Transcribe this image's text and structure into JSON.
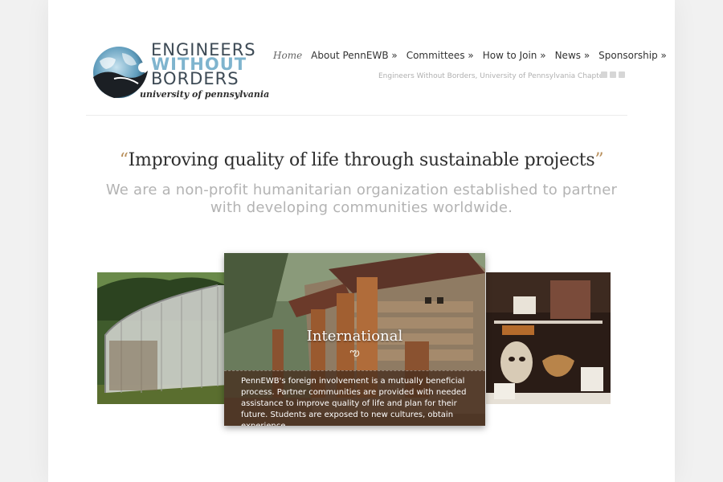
{
  "logo": {
    "line1": "ENGINEERS",
    "line2": "WITHOUT",
    "line3": "BORDERS",
    "line4": "university of pennsylvania"
  },
  "nav": {
    "items": [
      {
        "label": "Home"
      },
      {
        "label": "About PennEWB »"
      },
      {
        "label": "Committees »"
      },
      {
        "label": "How to Join »"
      },
      {
        "label": "News »"
      },
      {
        "label": "Sponsorship »"
      }
    ]
  },
  "header": {
    "tagline": "Engineers Without Borders, University of Pennsylvania Chapter",
    "social": [
      "twitter-icon",
      "rss-icon",
      "facebook-icon"
    ]
  },
  "hero": {
    "quote_open": "“",
    "quote_text": "Improving quality of life through sustainable projects",
    "quote_close": "”",
    "subtitle": "We are a non-profit humanitarian organization established to partner with developing communities worldwide."
  },
  "slider": {
    "center_title": "International",
    "ornament": "ఌ",
    "caption": "PennEWB's foreign involvement is a mutually beneficial process. Partner communities are provided with needed assistance to improve quality of life and plan for their future. Students are exposed to new cultures, obtain experience..."
  },
  "colors": {
    "accent": "#7fb4ce",
    "text_dark": "#2e2e2e",
    "quote_mark": "#b88f5b",
    "subtitle": "#b3b3b3"
  }
}
